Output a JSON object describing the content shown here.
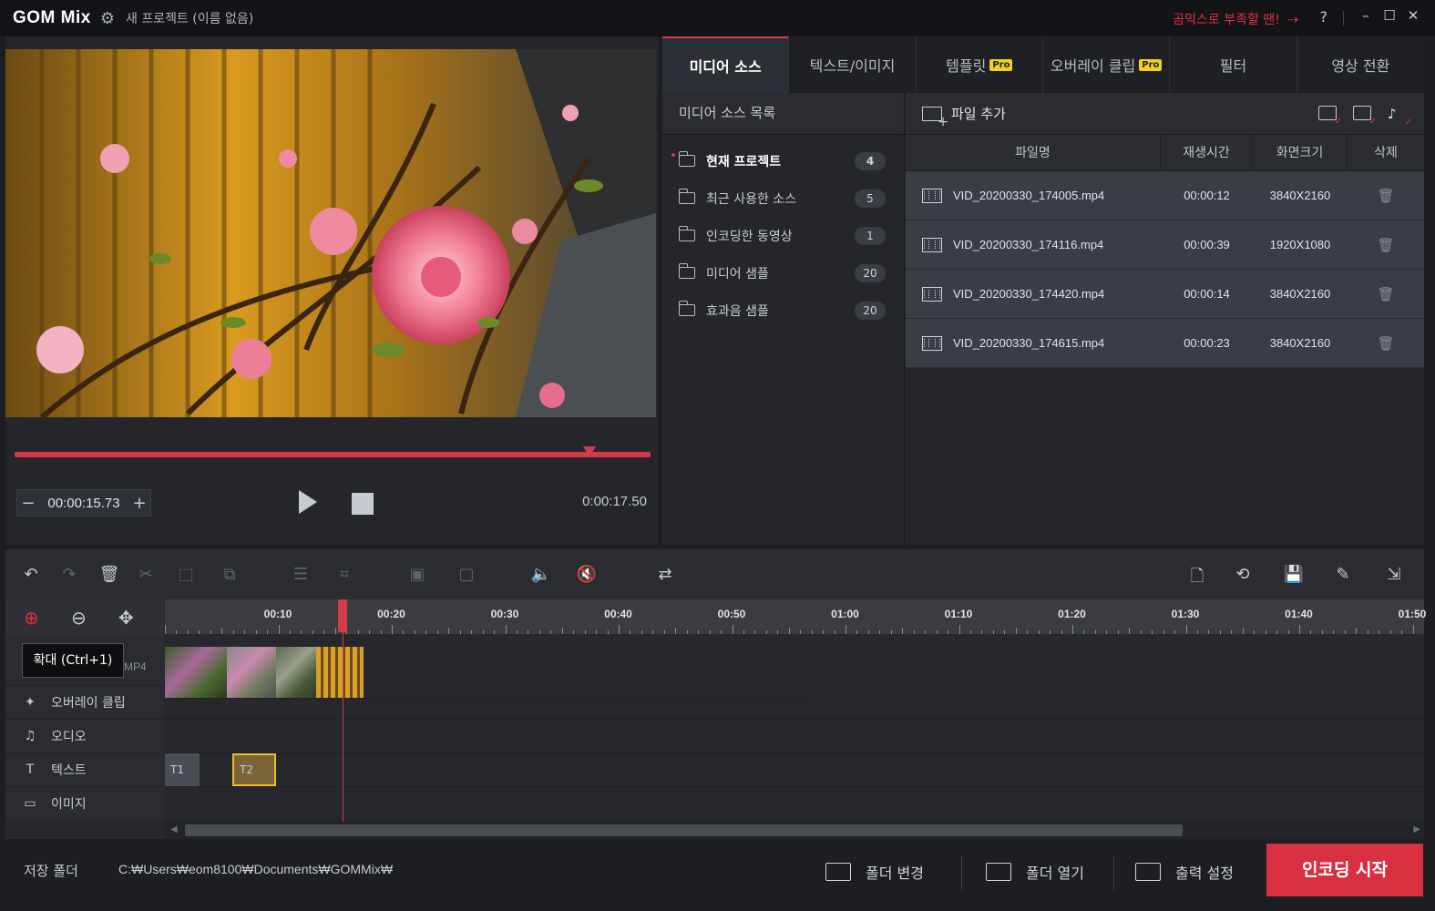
{
  "app": {
    "logo": "GOM Mix",
    "title": "새 프로젝트 (이름 없음)",
    "promo": "곰믹스로 부족할 땐!",
    "help": "?"
  },
  "preview": {
    "current_time": "00:00:15.73",
    "duration": "0:00:17.50",
    "progress": 0.9
  },
  "tabs": [
    {
      "label": "미디어 소스",
      "active": true
    },
    {
      "label": "텍스트/이미지"
    },
    {
      "label": "템플릿",
      "pro": "Pro"
    },
    {
      "label": "오버레이 클립",
      "pro": "Pro"
    },
    {
      "label": "필터"
    },
    {
      "label": "영상 전환"
    }
  ],
  "source_list": {
    "heading": "미디어 소스 목록",
    "items": [
      {
        "label": "현재 프로젝트",
        "count": "4"
      },
      {
        "label": "최근 사용한 소스",
        "count": "5"
      },
      {
        "label": "인코딩한 동영상",
        "count": "1"
      },
      {
        "label": "미디어 샘플",
        "count": "20"
      },
      {
        "label": "효과음 샘플",
        "count": "20"
      }
    ]
  },
  "files": {
    "add_label": "파일 추가",
    "columns": [
      "파일명",
      "재생시간",
      "화면크기",
      "삭제"
    ],
    "rows": [
      {
        "name": "VID_20200330_174005.mp4",
        "duration": "00:00:12",
        "size": "3840X2160"
      },
      {
        "name": "VID_20200330_174116.mp4",
        "duration": "00:00:39",
        "size": "1920X1080"
      },
      {
        "name": "VID_20200330_174420.mp4",
        "duration": "00:00:14",
        "size": "3840X2160"
      },
      {
        "name": "VID_20200330_174615.mp4",
        "duration": "00:00:23",
        "size": "3840X2160"
      }
    ]
  },
  "timeline": {
    "ticks": [
      "00:10",
      "00:20",
      "00:30",
      "00:40",
      "00:50",
      "01:00",
      "01:10",
      "01:20",
      "01:30",
      "01:40",
      "01:50"
    ],
    "tooltip": "확대 (Ctrl+1)",
    "video_tag": "MP4",
    "tracks": [
      "오버레이 클립",
      "오디오",
      "텍스트",
      "이미지"
    ],
    "text_clips": [
      "T1",
      "T2"
    ]
  },
  "bottom": {
    "save_label": "저장 폴더",
    "save_path": "C:₩Users₩eom8100₩Documents₩GOMMix₩",
    "change_folder": "폴더 변경",
    "open_folder": "폴더 열기",
    "output_settings": "출력 설정",
    "encode": "인코딩 시작"
  },
  "colors": {
    "accent": "#d8303f",
    "pro_badge": "#f0d21e"
  }
}
